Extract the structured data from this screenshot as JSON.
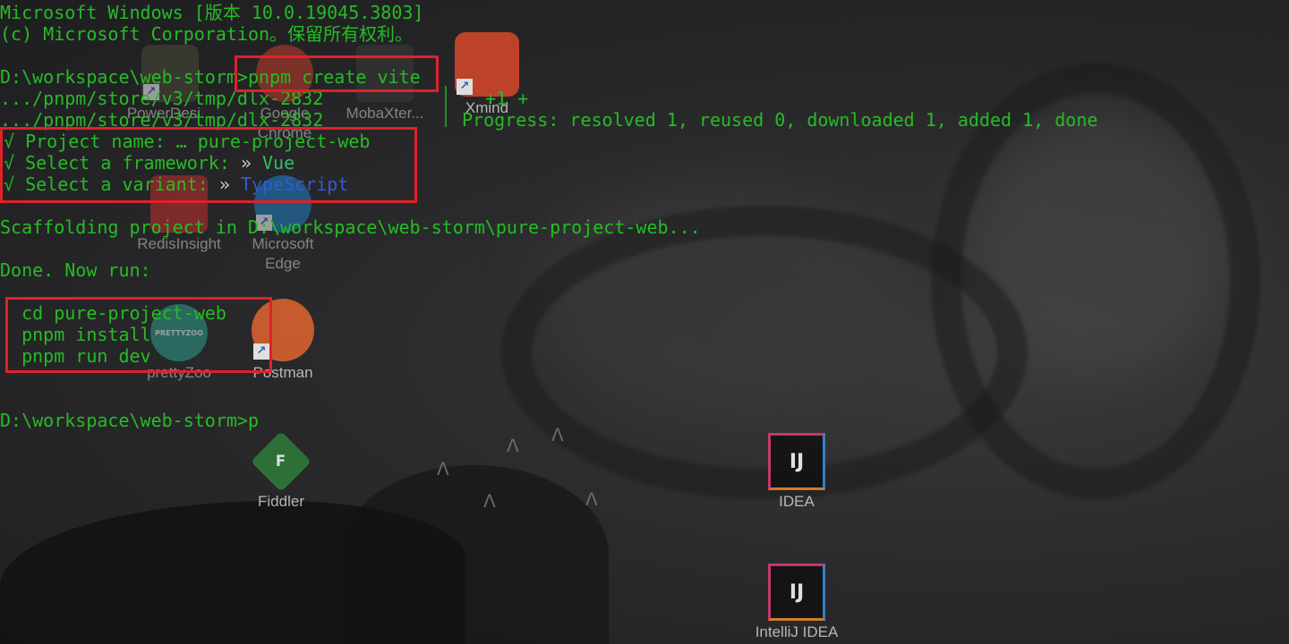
{
  "terminal": {
    "lines": [
      "Microsoft Windows [版本 10.0.19045.3803]",
      "(c) Microsoft Corporation。保留所有权利。",
      "D:\\workspace\\web-storm>",
      "pnpm create vite",
      ".../pnpm/store/v3/tmp/dlx-2832",
      ".../pnpm/store/v3/tmp/dlx-2832",
      "  +1 +",
      "Progress: resolved 1, reused 0, downloaded 1, added 1, done",
      "√ Project name: … pure-project-web",
      "√ Select a framework: ",
      "» ",
      "Vue",
      "√ Select a variant: ",
      "» ",
      "TypeScript",
      "Scaffolding project in D:\\workspace\\web-storm\\pure-project-web...",
      "Done. Now run:",
      "  cd pure-project-web",
      "  pnpm install",
      "  pnpm run dev",
      "D:\\workspace\\web-storm>p"
    ]
  },
  "desktop": {
    "icons": [
      {
        "label": "PowerDesi...",
        "icon": "powerdesigner-icon",
        "color": "#4a4a3a"
      },
      {
        "label": "Google Chrome",
        "icon": "chrome-icon",
        "color": "#c33b2b"
      },
      {
        "label": "MobaXter...",
        "icon": "mobaxterm-icon",
        "color": "#3a3a3a"
      },
      {
        "label": "Xmind",
        "icon": "xmind-icon",
        "color": "#d9472b"
      },
      {
        "label": "RedisInsight",
        "icon": "redisinsight-icon",
        "color": "#c42d2d"
      },
      {
        "label": "Microsoft Edge",
        "icon": "edge-icon",
        "color": "#1f7fc4"
      },
      {
        "label": "prettyZoo",
        "icon": "prettyzoo-icon",
        "color": "#2b9f8c"
      },
      {
        "label": "Postman",
        "icon": "postman-icon",
        "color": "#e0642f"
      },
      {
        "label": "Fiddler",
        "icon": "fiddler-icon",
        "color": "#2f7d3a"
      },
      {
        "label": "IDEA",
        "icon": "intellij-idea-icon",
        "color": "#111111"
      },
      {
        "label": "IntelliJ IDEA",
        "icon": "intellij-idea-icon",
        "color": "#111111"
      }
    ],
    "glyphs": {
      "idea": "IJ",
      "fiddler": "F",
      "prettyzoo": "PRETTYZOO"
    }
  },
  "colors": {
    "terminal_green": "#25bc24",
    "highlight_red": "#e0212a",
    "typescript_blue": "#2e5bd8",
    "background": "#2a2a2c"
  }
}
